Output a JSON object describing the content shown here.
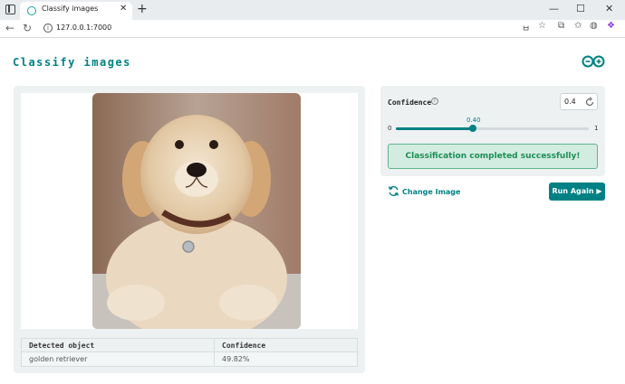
{
  "browser": {
    "tab_title": "Classify images",
    "url": "127.0.0.1:7000",
    "close_glyph": "✕",
    "new_tab_glyph": "+",
    "window_controls": [
      "—",
      "☐",
      "✕"
    ]
  },
  "app": {
    "title": "Classify images",
    "accent_color": "#008184"
  },
  "results": {
    "columns": [
      "Detected object",
      "Confidence"
    ],
    "rows": [
      {
        "object": "golden retriever",
        "confidence": "49.82%"
      }
    ]
  },
  "confidence": {
    "label": "Confidence",
    "input_value": "0.4",
    "slider_value_label": "0.40",
    "slider_fraction": 0.4,
    "min_label": "0",
    "max_label": "1"
  },
  "status": {
    "message": "Classification completed successfully!"
  },
  "actions": {
    "change_image_label": "Change Image",
    "run_again_label": "Run Again ▶"
  },
  "icons": {
    "tab_favicon": "app-favicon",
    "logo": "infinity-logo-icon",
    "info": "info-icon",
    "reset": "reset-icon",
    "change": "refresh-icon"
  }
}
